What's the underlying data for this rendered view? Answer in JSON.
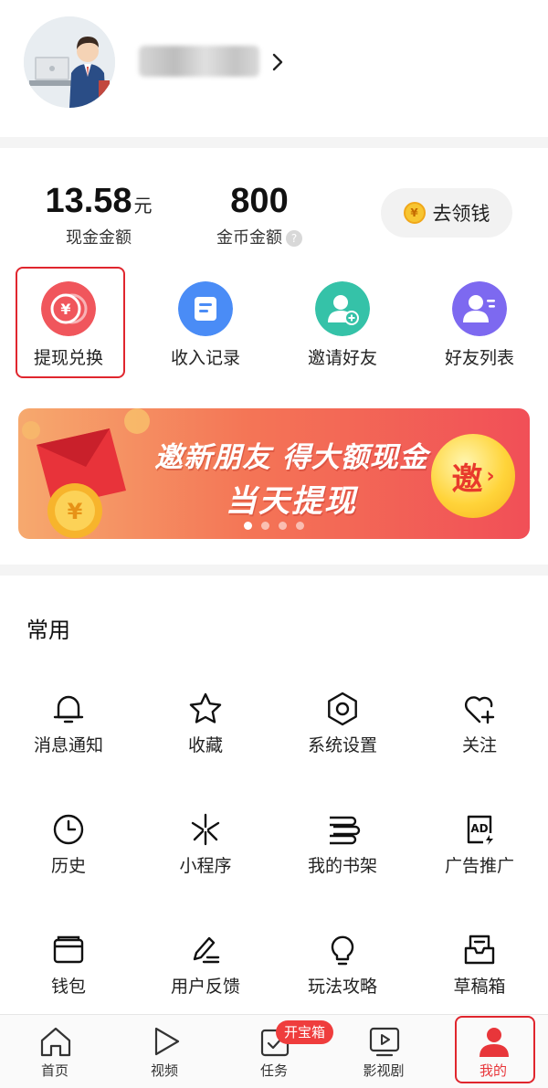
{
  "wallet": {
    "cash_value": "13.58",
    "cash_unit": "元",
    "cash_label": "现金金额",
    "coin_value": "800",
    "coin_label": "金币金额",
    "help_glyph": "?",
    "earn_button": "去领钱",
    "coin_glyph": "¥"
  },
  "quick_actions": [
    {
      "label": "提现兑换",
      "icon": "yuan-coin-icon",
      "color": "#f0565c"
    },
    {
      "label": "收入记录",
      "icon": "record-icon",
      "color": "#4a8cf6"
    },
    {
      "label": "邀请好友",
      "icon": "invite-friend-icon",
      "color": "#35c2a8"
    },
    {
      "label": "好友列表",
      "icon": "friend-list-icon",
      "color": "#7d69f0"
    }
  ],
  "banner": {
    "line1": "邀新朋友 得大额现金",
    "line2": "当天提现",
    "badge": "邀",
    "badge_arrow": "›",
    "page_count": 4,
    "active_page": 1
  },
  "common": {
    "title": "常用",
    "items": [
      {
        "label": "消息通知",
        "icon": "bell-icon"
      },
      {
        "label": "收藏",
        "icon": "star-icon"
      },
      {
        "label": "系统设置",
        "icon": "gear-icon"
      },
      {
        "label": "关注",
        "icon": "heart-plus-icon"
      },
      {
        "label": "历史",
        "icon": "clock-icon"
      },
      {
        "label": "小程序",
        "icon": "mini-program-icon"
      },
      {
        "label": "我的书架",
        "icon": "bookshelf-icon"
      },
      {
        "label": "广告推广",
        "icon": "ad-icon"
      },
      {
        "label": "钱包",
        "icon": "wallet-icon"
      },
      {
        "label": "用户反馈",
        "icon": "feedback-pen-icon"
      },
      {
        "label": "玩法攻略",
        "icon": "lightbulb-icon"
      },
      {
        "label": "草稿箱",
        "icon": "drafts-icon"
      }
    ]
  },
  "tabbar": {
    "tabs": [
      {
        "label": "首页",
        "icon": "home-icon"
      },
      {
        "label": "视频",
        "icon": "play-icon"
      },
      {
        "label": "任务",
        "icon": "task-icon"
      },
      {
        "label": "影视剧",
        "icon": "tv-play-icon"
      },
      {
        "label": "我的",
        "icon": "person-icon",
        "active": true
      }
    ],
    "task_badge": "开宝箱"
  },
  "colors": {
    "accent_red": "#e8363a",
    "highlight_box": "#e0262e"
  }
}
